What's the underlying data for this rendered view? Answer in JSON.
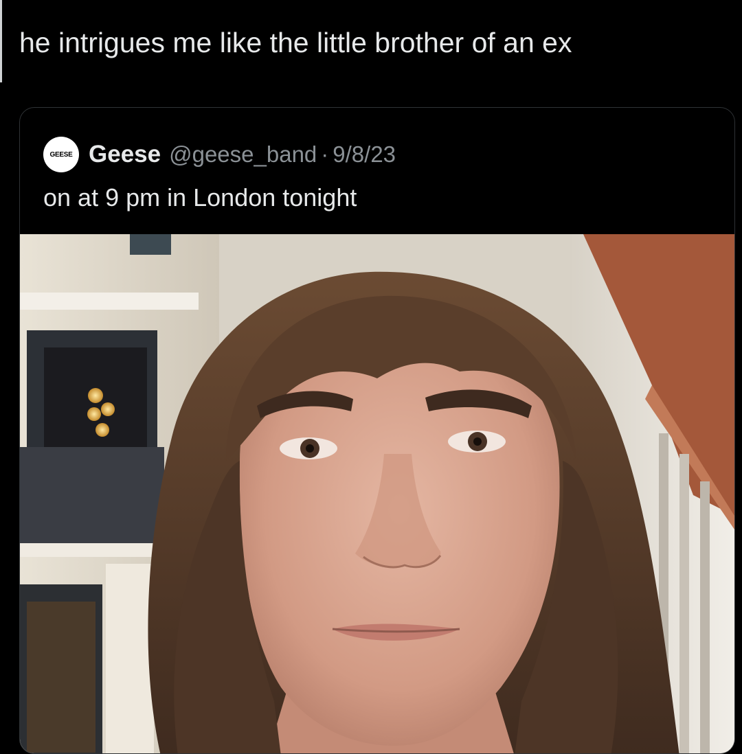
{
  "tweet": {
    "text": "he intrigues me like the little brother of an ex"
  },
  "quoted_tweet": {
    "avatar_text": "GEESE",
    "display_name": "Geese",
    "handle": "@geese_band",
    "separator": "·",
    "date": "9/8/23",
    "text": "on at 9 pm in London tonight",
    "media": {
      "icon": "selfie-photo",
      "colors": {
        "skin": "#d9a58f",
        "hair": "#5a3e2b",
        "building": "#c9c2b4",
        "awning": "#a4583a"
      }
    }
  }
}
